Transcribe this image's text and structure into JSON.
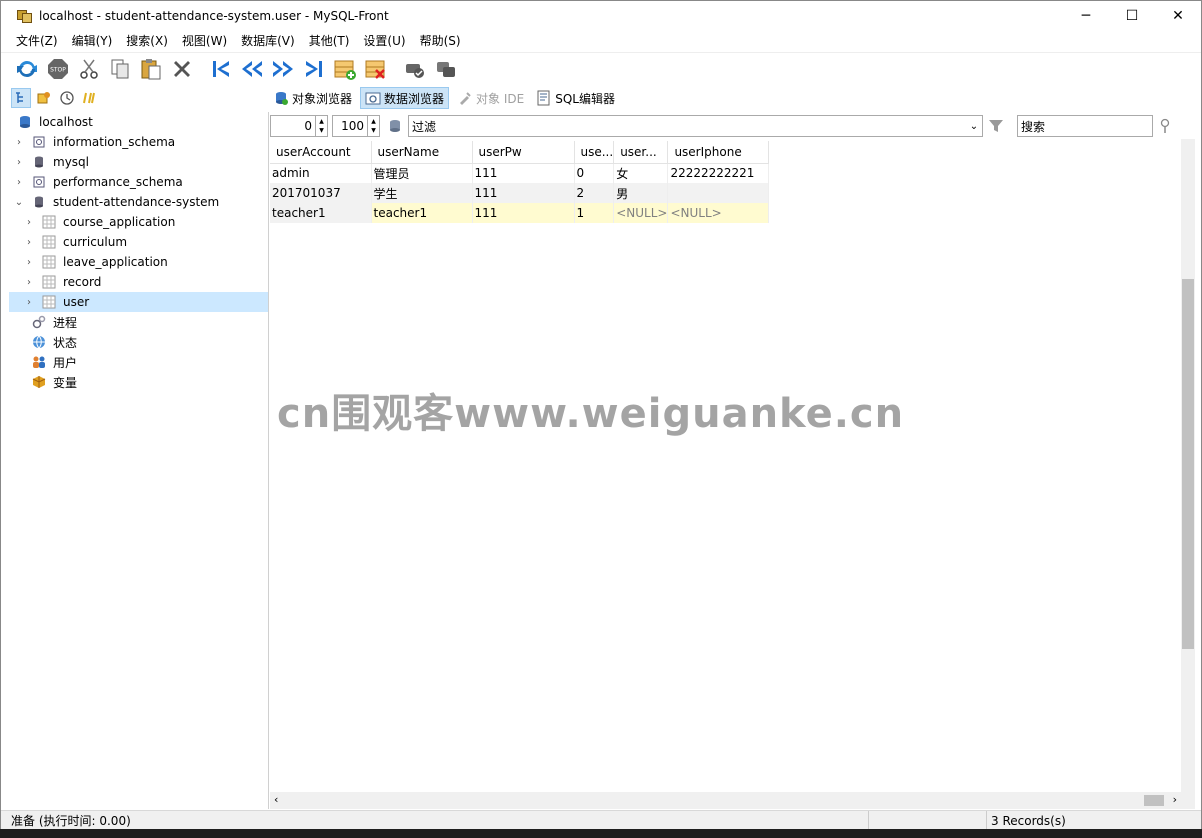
{
  "window": {
    "title": "localhost - student-attendance-system.user - MySQL-Front",
    "controls": {
      "minimize": "─",
      "maximize": "☐",
      "close": "✕"
    }
  },
  "menu": [
    "文件(Z)",
    "编辑(Y)",
    "搜索(X)",
    "视图(W)",
    "数据库(V)",
    "其他(T)",
    "设置(U)",
    "帮助(S)"
  ],
  "toolbar_icons": [
    "refresh-icon",
    "stop-icon",
    "cut-icon",
    "copy-icon",
    "paste-icon",
    "delete-icon",
    "first-record-icon",
    "prev-record-icon",
    "next-record-icon",
    "last-record-icon",
    "insert-record-icon",
    "delete-record-icon",
    "post-icon",
    "cancel-icon"
  ],
  "tabs": {
    "object_browser": "对象浏览器",
    "data_browser": "数据浏览器",
    "object_ide": "对象 IDE",
    "sql_editor": "SQL编辑器"
  },
  "tree": {
    "root": "localhost",
    "databases": [
      "information_schema",
      "mysql",
      "performance_schema"
    ],
    "active_db": "student-attendance-system",
    "tables": [
      "course_application",
      "curriculum",
      "leave_application",
      "record",
      "user"
    ],
    "selected_table": "user",
    "extras": [
      "进程",
      "状态",
      "用户",
      "变量"
    ]
  },
  "filter": {
    "offset": "0",
    "limit": "100",
    "filter_placeholder": "过滤",
    "search_placeholder": "搜索"
  },
  "grid": {
    "columns": [
      "userAccount",
      "userName",
      "userPw",
      "use...",
      "user...",
      "userIphone"
    ],
    "rows": [
      [
        "admin",
        "管理员",
        "111",
        "0",
        "女",
        "22222222221"
      ],
      [
        "201701037",
        "学生",
        "111",
        "2",
        "男",
        ""
      ],
      [
        "teacher1",
        "teacher1",
        "111",
        "1",
        "<NULL>",
        "<NULL>"
      ]
    ]
  },
  "status": {
    "left": "准备  (执行时间: 0.00)",
    "records": "3 Records(s)"
  },
  "watermark": "cn围观客www.weiguanke.cn"
}
